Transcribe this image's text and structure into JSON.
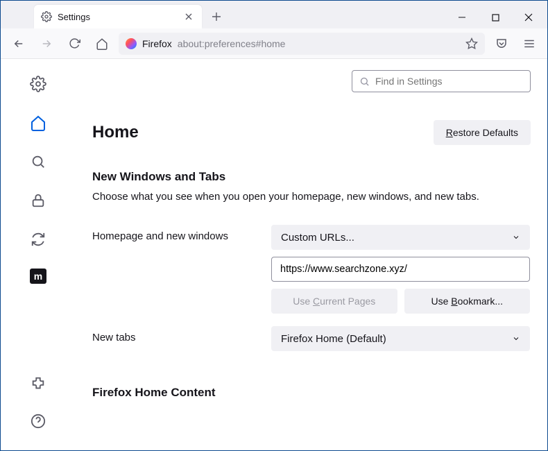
{
  "tab": {
    "title": "Settings"
  },
  "urlbar": {
    "label": "Firefox",
    "path": "about:preferences#home"
  },
  "search": {
    "placeholder": "Find in Settings"
  },
  "page": {
    "title": "Home",
    "restore": "Restore Defaults",
    "restore_ul": "R"
  },
  "section1": {
    "title": "New Windows and Tabs",
    "desc": "Choose what you see when you open your homepage, new windows, and new tabs."
  },
  "homepage": {
    "label": "Homepage and new windows",
    "select": "Custom URLs...",
    "value": "https://www.searchzone.xyz/",
    "useCurrent": "Use Current Pages",
    "useBookmark": "Use Bookmark..."
  },
  "newtabs": {
    "label": "New tabs",
    "select": "Firefox Home (Default)"
  },
  "section2": {
    "title": "Firefox Home Content"
  }
}
